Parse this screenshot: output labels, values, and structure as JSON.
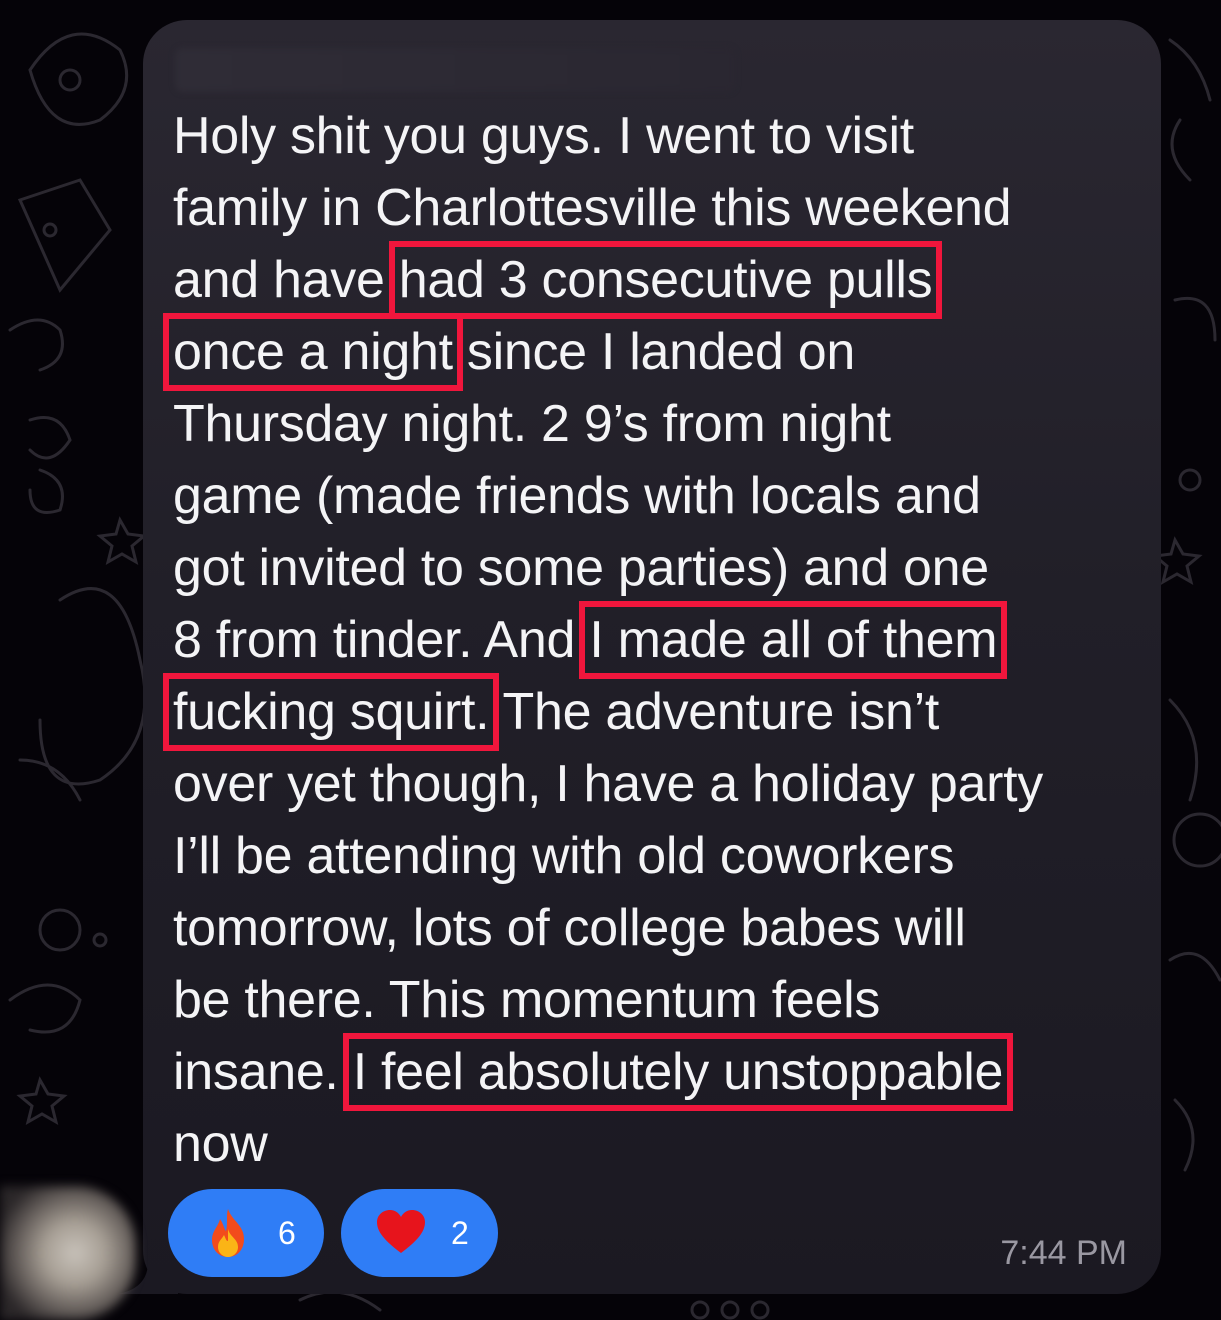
{
  "message": {
    "lines": [
      "Holy shit you guys. I went to visit",
      "family in Charlottesville this weekend",
      "and have ",
      "had 3 consecutive pulls",
      "once a night",
      " since I landed on",
      "Thursday night. 2 9’s from night",
      "game (made friends with locals and",
      "got invited to some parties) and one",
      "8 from tinder. And ",
      "I made all of them",
      "fucking squirt.",
      " The adventure isn’t",
      "over yet though, I have a holiday party",
      "I’ll be attending with old coworkers",
      "tomorrow, lots of college babes will",
      "be there. This momentum feels",
      "insane. ",
      "I feel absolutely unstoppable",
      "now"
    ]
  },
  "reactions": [
    {
      "emoji": "fire-emoji",
      "count": "6"
    },
    {
      "emoji": "heart-emoji",
      "count": "2"
    }
  ],
  "timestamp": "7:44 PM",
  "colors": {
    "highlight": "#f0163c",
    "reaction_bg": "#2f7df6",
    "bubble_bg": "#24222b"
  }
}
